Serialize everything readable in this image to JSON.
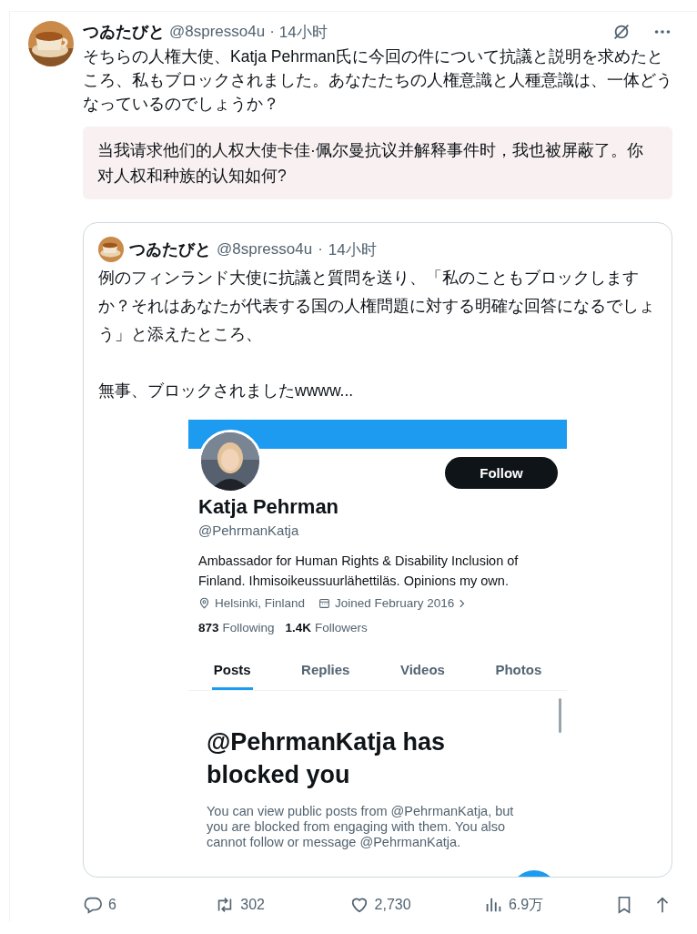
{
  "post": {
    "author": {
      "name": "つゐたびと",
      "handle": "@8spresso4u",
      "separator": "·",
      "time": "14小时"
    },
    "text": "そちらの人権大使、Katja Pehrman氏に今回の件について抗議と説明を求めたところ、私もブロックされました。あなたたちの人権意識と人種意識は、一体どうなっているのでしょうか？",
    "translation": "当我请求他们的人权大使卡佳·佩尔曼抗议并解释事件时，我也被屏蔽了。你对人权和种族的认知如何?",
    "quote": {
      "author": {
        "name": "つゐたびと",
        "handle": "@8spresso4u",
        "separator": "·",
        "time": "14小时"
      },
      "paragraphs": [
        "例のフィンランド大使に抗議と質問を送り、「私のこともブロックしますか？それはあなたが代表する国の人権問題に対する明確な回答になるでしょう」と添えたところ、",
        "無事、ブロックされましたwwww..."
      ],
      "screenshot": {
        "profile": {
          "name": "Katja Pehrman",
          "handle": "@PehrmanKatja",
          "bio": "Ambassador for Human Rights & Disability Inclusion of Finland. Ihmisoikeussuurlähettiläs. Opinions my own.",
          "location": "Helsinki, Finland",
          "joined": "Joined February 2016",
          "following_count": "873",
          "following_label": "Following",
          "followers_count": "1.4K",
          "followers_label": "Followers",
          "follow_button": "Follow"
        },
        "tabs": [
          {
            "label": "Posts",
            "selected": true
          },
          {
            "label": "Replies",
            "selected": false
          },
          {
            "label": "Videos",
            "selected": false
          },
          {
            "label": "Photos",
            "selected": false
          }
        ],
        "blocked": {
          "title": "@PehrmanKatja has blocked you",
          "body": "You can view public posts from @PehrmanKatja, but you are blocked from engaging with them. You also cannot follow or message @PehrmanKatja."
        }
      }
    },
    "actions": [
      {
        "kind": "reply",
        "count": "6"
      },
      {
        "kind": "repost",
        "count": "302"
      },
      {
        "kind": "like",
        "count": "2,730"
      },
      {
        "kind": "views",
        "count": "6.9万"
      },
      {
        "kind": "bookmark"
      },
      {
        "kind": "share"
      }
    ]
  }
}
